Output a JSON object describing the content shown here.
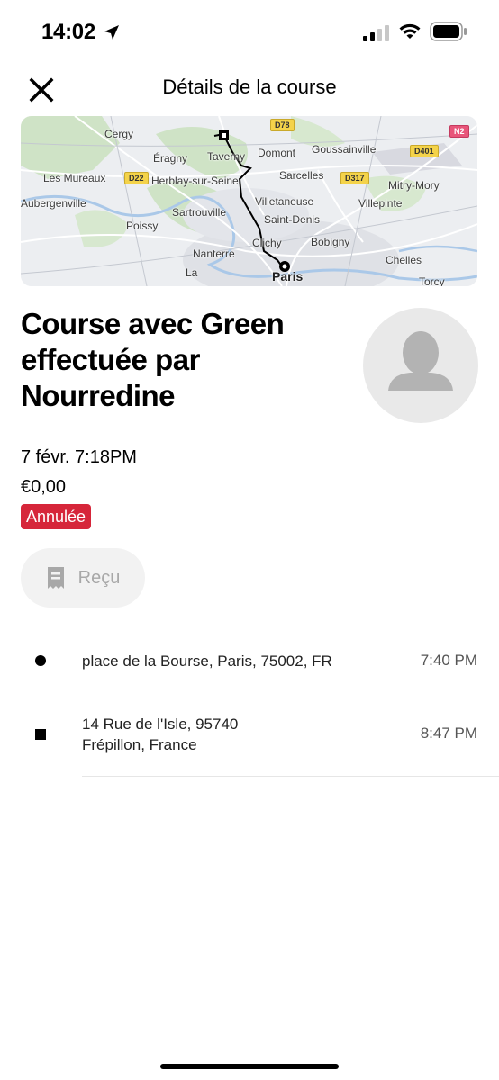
{
  "status_bar": {
    "time": "14:02",
    "icons": [
      "location-arrow-icon",
      "cellular-signal-icon",
      "wifi-icon",
      "battery-icon"
    ]
  },
  "nav": {
    "title": "Détails de la course",
    "close_icon": "close-icon"
  },
  "map": {
    "labels": [
      "Cergy",
      "Éragny",
      "Taverny",
      "Domont",
      "Goussainville",
      "Sarcelles",
      "Mitry-Mory",
      "Les Mureaux",
      "Herblay-sur-Seine",
      "Villetaneuse",
      "Villepinte",
      "Aubergenville",
      "Sartrouville",
      "Saint-Denis",
      "Poissy",
      "Clichy",
      "Bobigny",
      "Nanterre",
      "Chelles",
      "La",
      "Paris",
      "Torcy"
    ],
    "road_badges": [
      "D78",
      "N2",
      "D401",
      "D22",
      "D317"
    ],
    "route_start_marker": "square",
    "route_end_marker": "circle"
  },
  "ride": {
    "title": "Course avec Green effectuée par Nourredine",
    "date": "7 févr. 7:18PM",
    "price": "€0,00",
    "status": "Annulée",
    "receipt_label": "Reçu",
    "avatar_icon": "person-silhouette-icon"
  },
  "stops": [
    {
      "address_line1": "place de la Bourse, Paris, 75002, FR",
      "address_line2": "",
      "time": "7:40 PM",
      "marker": "dot"
    },
    {
      "address_line1": "14 Rue de l'Isle, 95740",
      "address_line2": "Frépillon, France",
      "time": "8:47 PM",
      "marker": "square"
    }
  ],
  "colors": {
    "status_badge_bg": "#d6263a",
    "receipt_bg": "#f2f2f2",
    "receipt_text": "#a8a8a8"
  }
}
